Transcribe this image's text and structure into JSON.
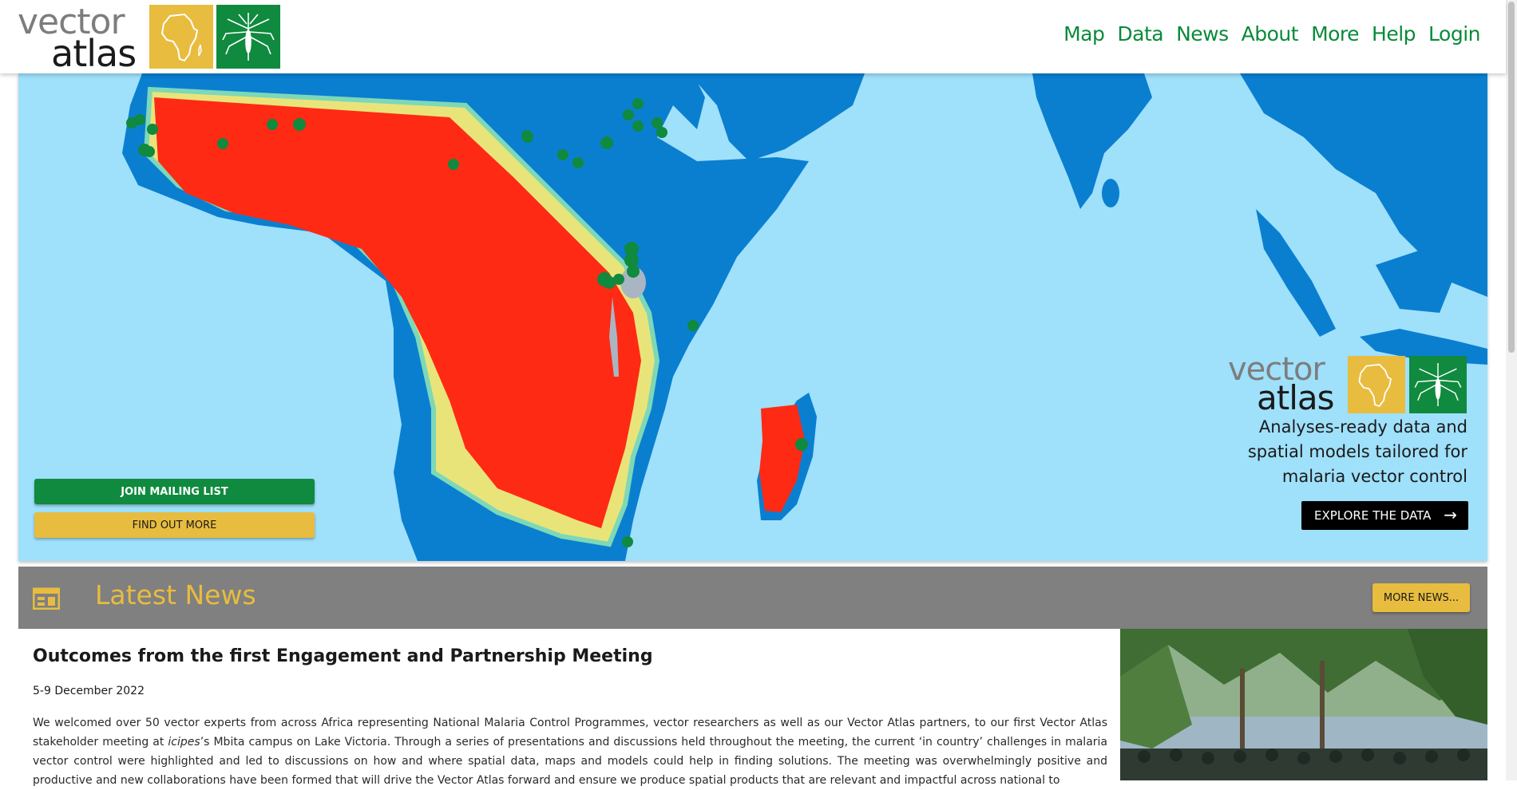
{
  "brand": {
    "word1": "vector",
    "word2": "atlas"
  },
  "nav": {
    "items": [
      "Map",
      "Data",
      "News",
      "About",
      "More",
      "Help",
      "Login"
    ]
  },
  "hero": {
    "join_button": "JOIN MAILING LIST",
    "find_button": "FIND OUT MORE",
    "tagline_lines": [
      "Analyses-ready data and",
      "spatial models tailored for",
      "malaria vector control"
    ],
    "explore_button": "EXPLORE THE DATA",
    "explore_icon": "arrow-right-icon"
  },
  "news": {
    "section_title": "Latest News",
    "section_icon": "calendar-icon",
    "more_button": "MORE NEWS...",
    "article": {
      "title": "Outcomes from the first Engagement and Partnership Meeting",
      "date": "5-9 December 2022",
      "body_part1": "We welcomed over 50 vector experts from across Africa  representing National Malaria Control Programmes, vector researchers as well as our Vector Atlas partners, to our first Vector Atlas stakeholder meeting at ",
      "body_em": "icipes",
      "body_part2": "’s Mbita campus on Lake Victoria.  Through a series of presentations and discussions held throughout the meeting, the current ‘in country’ challenges in malaria vector control were highlighted and led to discussions on how and where spatial data, maps and models could help in finding solutions. The meeting was overwhelmingly positive and productive and new collaborations have been formed that will drive the Vector Atlas forward and ensure  we produce spatial products that are relevant and impactful across national to"
    }
  },
  "colors": {
    "brand_green": "#0f8a3e",
    "brand_yellow": "#e8bc3f",
    "ocean": "#9fe0fb",
    "land": "#0a7fd0",
    "habitat_high": "#ff2a14",
    "news_bar": "#808080"
  }
}
